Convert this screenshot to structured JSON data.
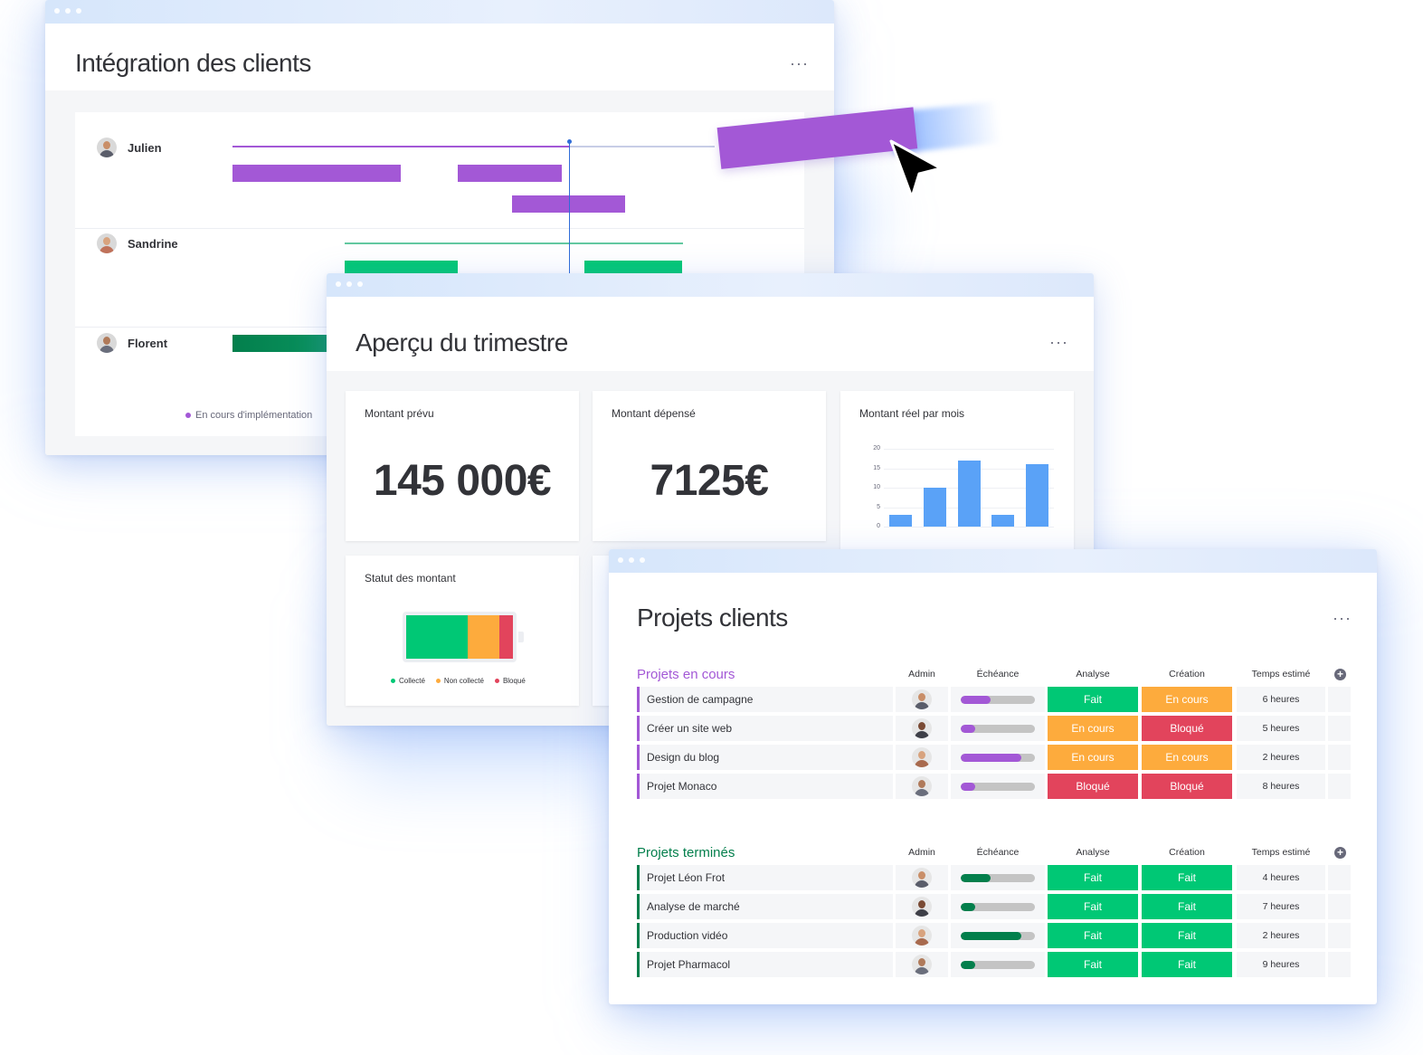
{
  "colors": {
    "purple": "#a358d6",
    "green": "#00c875",
    "dark_green": "#037f4c",
    "orange": "#fdab3d",
    "red": "#e2445c",
    "blue": "#579bfc",
    "chart_blue": "#5aa2f7"
  },
  "onboarding": {
    "title": "Intégration des clients",
    "more_icon": "···",
    "people": [
      {
        "name": "Julien"
      },
      {
        "name": "Sandrine"
      },
      {
        "name": "Florent"
      }
    ],
    "legend": {
      "label": "En cours d'implémentation"
    }
  },
  "quarter": {
    "title": "Aperçu du trimestre",
    "more_icon": "···",
    "planned": {
      "label": "Montant prévu",
      "value": "145 000€"
    },
    "spent": {
      "label": "Montant dépensé",
      "value": "7125€"
    },
    "monthly": {
      "label": "Montant réel par mois"
    },
    "status": {
      "label": "Statut des montant",
      "legend": [
        "Collecté",
        "Non collecté",
        "Bloqué"
      ]
    }
  },
  "chart_data": {
    "type": "bar",
    "title": "Montant réel par mois",
    "categories": [
      "",
      "",
      "",
      "",
      ""
    ],
    "values": [
      3,
      10,
      17,
      3,
      16
    ],
    "ylim": [
      0,
      20
    ],
    "yticks": [
      "20",
      "15",
      "10",
      "5",
      "0"
    ],
    "grid": true
  },
  "projects": {
    "title": "Projets clients",
    "more_icon": "···",
    "columns": {
      "admin": "Admin",
      "due": "Échéance",
      "analysis": "Analyse",
      "creation": "Création",
      "time": "Temps estimé"
    },
    "groups": [
      {
        "title": "Projets en cours",
        "color": "#a358d6",
        "rows": [
          {
            "name": "Gestion de campagne",
            "progress": 0.4,
            "analysis": "Fait",
            "analysis_color": "#00c875",
            "creation": "En cours",
            "creation_color": "#fdab3d",
            "time": "6 heures"
          },
          {
            "name": "Créer un site web",
            "progress": 0.2,
            "analysis": "En cours",
            "analysis_color": "#fdab3d",
            "creation": "Bloqué",
            "creation_color": "#e2445c",
            "time": "5 heures"
          },
          {
            "name": "Design du blog",
            "progress": 0.82,
            "analysis": "En cours",
            "analysis_color": "#fdab3d",
            "creation": "En cours",
            "creation_color": "#fdab3d",
            "time": "2 heures"
          },
          {
            "name": "Projet Monaco",
            "progress": 0.2,
            "analysis": "Bloqué",
            "analysis_color": "#e2445c",
            "creation": "Bloqué",
            "creation_color": "#e2445c",
            "time": "8 heures"
          }
        ]
      },
      {
        "title": "Projets terminés",
        "color": "#037f4c",
        "rows": [
          {
            "name": "Projet Léon Frot",
            "progress": 0.4,
            "analysis": "Fait",
            "analysis_color": "#00c875",
            "creation": "Fait",
            "creation_color": "#00c875",
            "time": "4 heures"
          },
          {
            "name": "Analyse de marché",
            "progress": 0.2,
            "analysis": "Fait",
            "analysis_color": "#00c875",
            "creation": "Fait",
            "creation_color": "#00c875",
            "time": "7 heures"
          },
          {
            "name": "Production vidéo",
            "progress": 0.82,
            "analysis": "Fait",
            "analysis_color": "#00c875",
            "creation": "Fait",
            "creation_color": "#00c875",
            "time": "2 heures"
          },
          {
            "name": "Projet Pharmacol",
            "progress": 0.2,
            "analysis": "Fait",
            "analysis_color": "#00c875",
            "creation": "Fait",
            "creation_color": "#00c875",
            "time": "9 heures"
          }
        ]
      }
    ]
  }
}
